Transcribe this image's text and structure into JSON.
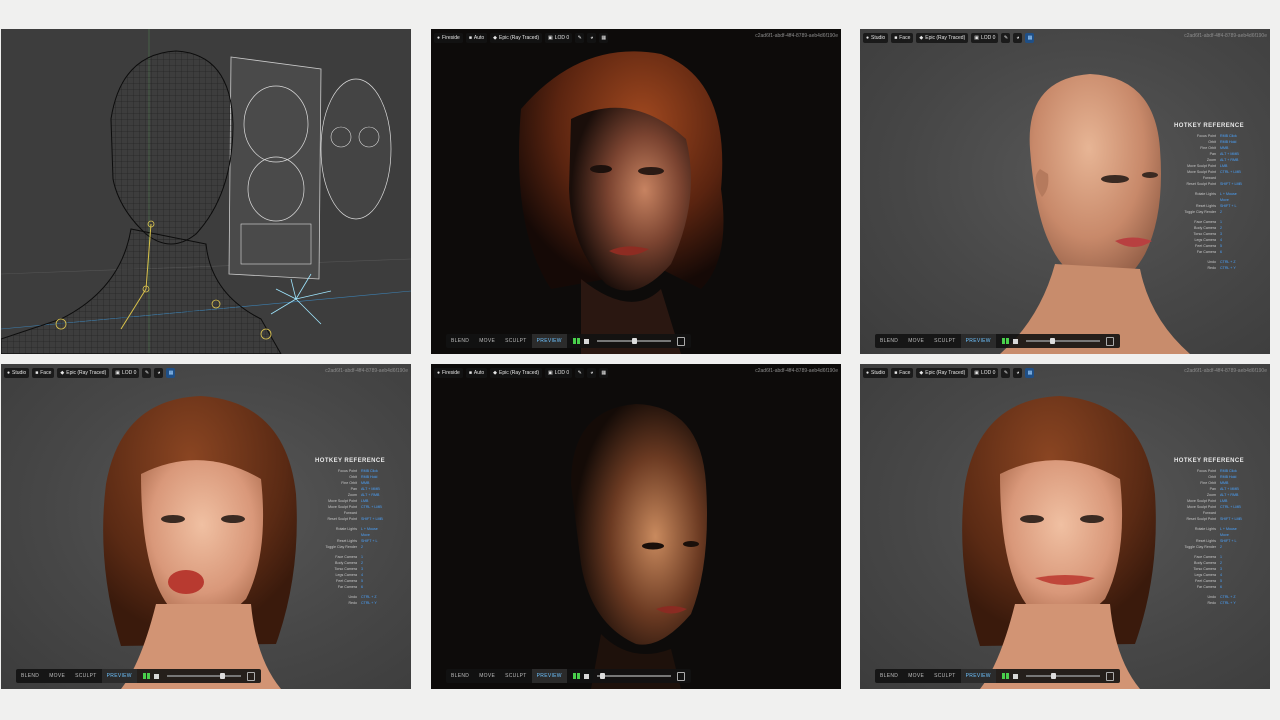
{
  "top_bar": {
    "light": "Studio",
    "light_fireside": "Fireside",
    "mode_face": "Face",
    "mode_auto": "Auto",
    "quality": "Epic (Ray Traced)",
    "lod": "LOD 0"
  },
  "corner_id": "c2ad6f1-abdf-4ff4-8789-aeb4d6f190e",
  "bottom_bar": {
    "blend": "BLEND",
    "move": "MOVE",
    "sculpt": "SCULPT",
    "preview": "PREVIEW"
  },
  "hotkeys": {
    "title": "HOTKEY REFERENCE",
    "group1": [
      {
        "label": "Focus Point",
        "key": "RMB Click"
      },
      {
        "label": "Orbit",
        "key": "RMB Hold"
      },
      {
        "label": "Fine Orbit",
        "key": "MMB"
      },
      {
        "label": "Pan",
        "key": "ALT + MMB"
      },
      {
        "label": "Zoom",
        "key": "ALT + RMB"
      },
      {
        "label": "Move Sculpt Point",
        "key": "LMB"
      },
      {
        "label": "Move Sculpt Point Forward",
        "key": "CTRL + LMB"
      },
      {
        "label": "Reset Sculpt Point",
        "key": "SHIFT + LMB"
      }
    ],
    "group2": [
      {
        "label": "Rotate Lights",
        "key": "L + Mouse Move"
      },
      {
        "label": "Reset Lights",
        "key": "SHIFT + L"
      },
      {
        "label": "Toggle Clay Render",
        "key": "2"
      }
    ],
    "group3": [
      {
        "label": "Face Camera",
        "key": "1"
      },
      {
        "label": "Body Camera",
        "key": "2"
      },
      {
        "label": "Torso Camera",
        "key": "3"
      },
      {
        "label": "Legs Camera",
        "key": "4"
      },
      {
        "label": "Feet Camera",
        "key": "5"
      },
      {
        "label": "Far Camera",
        "key": "6"
      }
    ],
    "group4": [
      {
        "label": "Undo",
        "key": "CTRL + Z"
      },
      {
        "label": "Redo",
        "key": "CTRL + Y"
      }
    ]
  }
}
